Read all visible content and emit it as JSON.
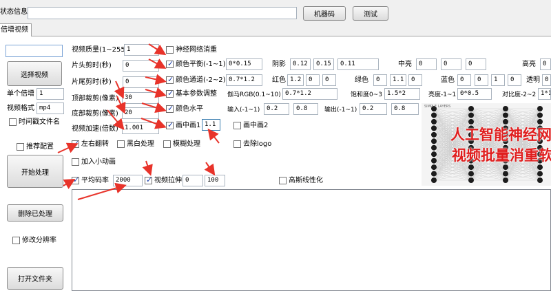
{
  "top": {
    "status_label": "状态信息",
    "status_value": "",
    "machine_code_button": "机器码",
    "test_button": "测试"
  },
  "tab": {
    "label": "倍增视频"
  },
  "left": {
    "small_input": "",
    "select_video_button": "选择视频",
    "multiplier_label": "单个倍增",
    "multiplier_value": "1",
    "format_label": "视频格式",
    "format_value": "mp4",
    "timestamp_name_label": "时间戳文件名",
    "recommended_config_label": "推荐配置",
    "start_button": "开始处理",
    "delete_processed_button": "删除已处理",
    "change_resolution_label": "修改分辨率",
    "open_folder_button": "打开文件夹"
  },
  "params": {
    "quality_label": "视频质量(1~255)",
    "quality_value": "1",
    "head_cut_label": "片头剪时(秒)",
    "head_cut_value": "0",
    "tail_cut_label": "片尾剪时(秒)",
    "tail_cut_value": "0",
    "top_crop_label": "顶部裁剪(像素)",
    "top_crop_value": "30",
    "bottom_crop_label": "底部裁剪(像素)",
    "bottom_crop_value": "20",
    "speed_label": "视频加速(倍数)",
    "speed_value": "1.001"
  },
  "options": {
    "neural_denoise": "神经网络消重",
    "color_balance": "颜色平衡(-1~1)",
    "color_balance_value": "0*0.15",
    "shadow_label": "阴影",
    "shadow_values": [
      "0.12",
      "0.15",
      "0.11"
    ],
    "midtone_label": "中亮",
    "midtone_values": [
      "0",
      "0",
      "0"
    ],
    "highlight_label": "高亮",
    "highlight_value": "0",
    "color_channel": "颜色通道(-2~2)",
    "color_channel_value": "0.7*1.2",
    "red_label": "红色",
    "red_values": [
      "1.2",
      "0",
      "0"
    ],
    "green_label": "绿色",
    "green_values": [
      "0",
      "1.1",
      "0"
    ],
    "blue_label": "蓝色",
    "blue_values": [
      "0",
      "0",
      "1",
      "0"
    ],
    "alpha_label": "透明",
    "alpha_value": "0",
    "basic_params": "基本参数调整",
    "gamma_label": "伽马RGB(0.1~10)",
    "gamma_value": "0.7*1.2",
    "saturation_label": "饱和度0~3",
    "saturation_value": "1.5*2",
    "brightness_label": "亮度-1~1",
    "brightness_value": "0*0.5",
    "contrast_label": "对比度-2~2",
    "contrast_value": "1*1",
    "color_level": "颜色水平",
    "input_label": "输入(-1~1)",
    "input_values": [
      "0.2",
      "0.8"
    ],
    "output_label": "输出(-1~1)",
    "output_values": [
      "0.2",
      "0.8"
    ],
    "pip1_label": "画中画1",
    "pip1_value": "1.1",
    "pip2_label": "画中画2",
    "flip_label": "左右翻转",
    "bw_label": "黑白处理",
    "blur_label": "模糊处理",
    "remove_logo_label": "去除logo",
    "add_animation_label": "加入小动画",
    "avg_bitrate_label": "平均码率",
    "avg_bitrate_value": "2000",
    "stretch_label": "视频拉伸",
    "stretch_value_1": "0",
    "stretch_value_2": "100",
    "gauss_label": "高斯线性化"
  },
  "banner": {
    "line1": "人工智能神经网",
    "line2": "视频批量消重软",
    "caption": "SIMPLE LAYERS"
  },
  "colors": {
    "arrow": "#e8332a",
    "banner_text": "#e01e1e",
    "checkbox_tick": "#1a3fa8"
  }
}
